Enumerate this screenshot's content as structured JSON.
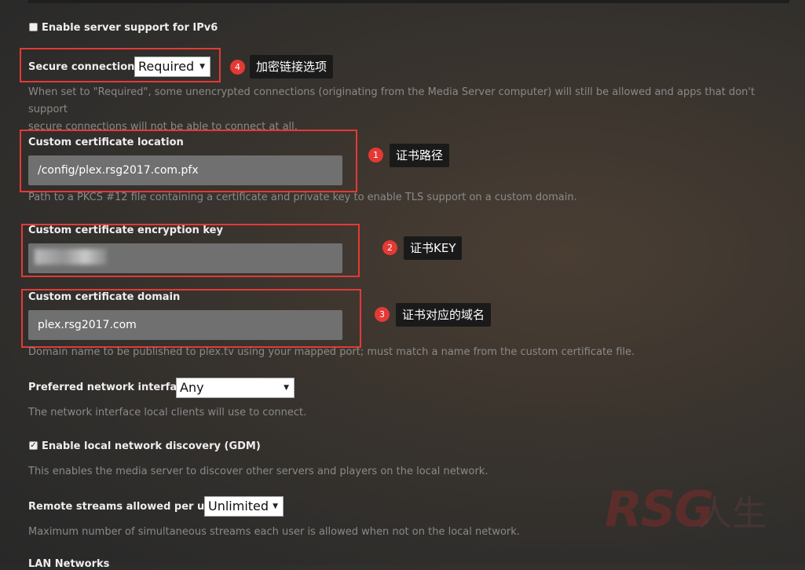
{
  "ipv6": {
    "label": "Enable server support for IPv6",
    "checked": false
  },
  "secure": {
    "label": "Secure connections",
    "value": "Required",
    "help_line1": "When set to \"Required\", some unencrypted connections (originating from the Media Server computer) will still be allowed and apps that don't support",
    "help_line2": "secure connections will not be able to connect at all."
  },
  "cert_location": {
    "label": "Custom certificate location",
    "value": "/config/plex.rsg2017.com.pfx",
    "help": "Path to a PKCS #12 file containing a certificate and private key to enable TLS support on a custom domain."
  },
  "cert_key": {
    "label": "Custom certificate encryption key",
    "value": ""
  },
  "cert_domain": {
    "label": "Custom certificate domain",
    "value": "plex.rsg2017.com",
    "help": "Domain name to be published to plex.tv using your mapped port; must match a name from the custom certificate file."
  },
  "network_iface": {
    "label": "Preferred network interface",
    "value": "Any",
    "help": "The network interface local clients will use to connect."
  },
  "gdm": {
    "label": "Enable local network discovery (GDM)",
    "checked": true,
    "help": "This enables the media server to discover other servers and players on the local network."
  },
  "remote_streams": {
    "label": "Remote streams allowed per user",
    "value": "Unlimited",
    "help": "Maximum number of simultaneous streams each user is allowed when not on the local network."
  },
  "lan_networks": {
    "label": "LAN Networks"
  },
  "annotations": [
    {
      "num": "4",
      "text": "加密链接选项"
    },
    {
      "num": "1",
      "text": "证书路径"
    },
    {
      "num": "2",
      "text": "证书KEY"
    },
    {
      "num": "3",
      "text": "证书对应的域名"
    }
  ],
  "watermark": {
    "brand": "RSG",
    "suffix": "人生"
  },
  "colors": {
    "annotation_red": "#e53935",
    "callout_bg": "#1a1a1a",
    "field_bg": "#707070"
  }
}
